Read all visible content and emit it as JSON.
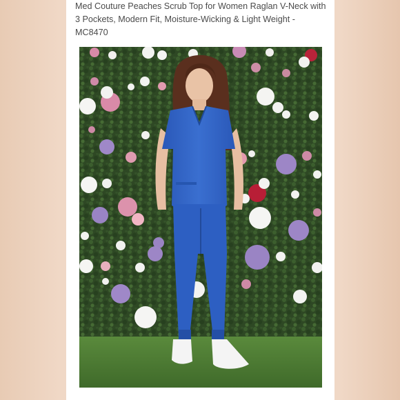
{
  "product": {
    "title": "Med Couture Peaches Scrub Top for Women Raglan V-Neck with 3 Pockets, Modern Fit, Moisture-Wicking & Light Weight - MC8470"
  },
  "photo": {
    "subject": "product-photo-model",
    "scrub_color": "#2f62c4",
    "wall_color": "#2f4a25",
    "floor_color": "#4d7a35",
    "shoe_color": "#f4f4f4"
  }
}
